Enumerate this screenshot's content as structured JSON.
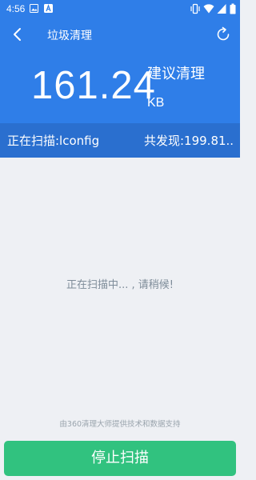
{
  "status_bar": {
    "time": "4:56"
  },
  "header": {
    "title": "垃圾清理",
    "back_icon": "chevron-left-icon",
    "refresh_icon": "refresh-icon"
  },
  "summary": {
    "size_value": "161.24",
    "size_unit": "KB",
    "suggest_label": "建议清理"
  },
  "scan_strip": {
    "current_label": "正在扫描:lconfig",
    "found_label": "共发现:199.81.."
  },
  "body": {
    "scanning_text": "正在扫描中... , 请稍候!",
    "credit_text": "由360清理大师提供技术和数据支持"
  },
  "actions": {
    "stop_label": "停止扫描"
  },
  "colors": {
    "primary_blue": "#2f7ee8",
    "strip_blue": "#2a6fcf",
    "button_green": "#31c27f",
    "background": "#eef0f4"
  }
}
